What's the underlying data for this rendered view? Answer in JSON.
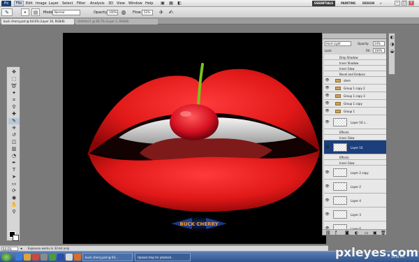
{
  "menubar": {
    "logo": "Ps",
    "items": [
      "File",
      "Edit",
      "Image",
      "Layer",
      "Select",
      "Filter",
      "Analysis",
      "3D",
      "View",
      "Window",
      "Help"
    ],
    "workspaces": [
      "ESSENTIALS",
      "PAINTING",
      "DESIGN"
    ]
  },
  "options": {
    "mode_label": "Mode:",
    "mode_value": "Normal",
    "opacity_label": "Opacity:",
    "opacity_value": "100%",
    "flow_label": "Flow:",
    "flow_value": "52%"
  },
  "tabs": [
    {
      "label": "buck cherry.psd @ 64.6% (Layer 16, RGB/8)"
    },
    {
      "label": "Untitled-1 @ 66.7% (Layer 1, RGB/8)"
    }
  ],
  "canvas": {
    "logo_text": "BUCK CHERRY",
    "colors": {
      "lip": "#e01818",
      "cherry": "#d41020",
      "stem": "#7dc21c",
      "background": "#000000"
    }
  },
  "status": {
    "zoom": "64.6%",
    "message": "Exposure works in 32-bit only"
  },
  "layers": {
    "blend_mode": "Hard Light",
    "opacity_label": "Opacity:",
    "opacity_value": "24%",
    "lock_label": "Lock:",
    "fill_label": "Fill:",
    "fill_value": "100%",
    "rows": [
      {
        "name": "Drop Shadow",
        "kind": "effect"
      },
      {
        "name": "Inner Shadow",
        "kind": "effect"
      },
      {
        "name": "Inner Glow",
        "kind": "effect"
      },
      {
        "name": "Bevel and Emboss",
        "kind": "effect"
      },
      {
        "name": "stem",
        "kind": "group"
      },
      {
        "name": "Group 1 copy 2",
        "kind": "group"
      },
      {
        "name": "Group 1 copy 3",
        "kind": "group"
      },
      {
        "name": "Group 1 copy",
        "kind": "group"
      },
      {
        "name": "Group 1",
        "kind": "group"
      },
      {
        "name": "Layer 16 c...",
        "kind": "layer"
      },
      {
        "name": "Effects",
        "kind": "effect"
      },
      {
        "name": "Inner Glow",
        "kind": "effect"
      },
      {
        "name": "Layer 16",
        "kind": "layer",
        "selected": true
      },
      {
        "name": "Effects",
        "kind": "effect"
      },
      {
        "name": "Inner Glow",
        "kind": "effect"
      },
      {
        "name": "Layer 2 copy",
        "kind": "layer"
      },
      {
        "name": "Layer 2",
        "kind": "layer"
      },
      {
        "name": "Layer 4",
        "kind": "layer"
      },
      {
        "name": "Layer 3",
        "kind": "layer"
      },
      {
        "name": "Layer 6",
        "kind": "layer"
      }
    ]
  },
  "taskbar": {
    "buttons": [
      "buck cherry.psd @ 64...",
      "Upload step for photosh..."
    ],
    "clock": "10:34 PM"
  },
  "watermark": "pxleyes.com"
}
